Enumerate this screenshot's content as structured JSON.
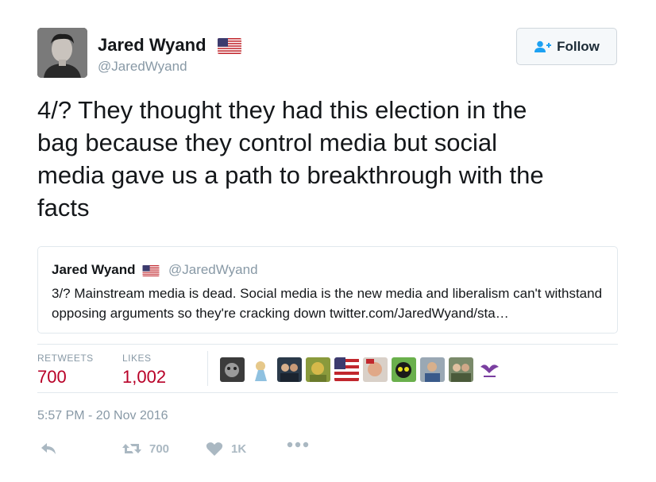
{
  "author": {
    "name": "Jared Wyand",
    "handle": "@JaredWyand"
  },
  "follow_label": "Follow",
  "tweet_text": "4/? They thought they had this election in the\nbag because they control media but social\nmedia gave us a path to breakthrough with the\nfacts",
  "quoted": {
    "name": "Jared Wyand",
    "handle": "@JaredWyand",
    "text": "3/? Mainstream media is dead. Social media is the new media and liberalism can't withstand opposing arguments so they're cracking down twitter.com/JaredWyand/sta…"
  },
  "stats": {
    "retweets_label": "RETWEETS",
    "retweets_value": "700",
    "likes_label": "LIKES",
    "likes_value": "1,002"
  },
  "timestamp": "5:57 PM - 20 Nov 2016",
  "actions": {
    "retweet_count": "700",
    "like_count": "1K"
  },
  "colors": {
    "accent_red": "#b80027",
    "muted": "#8899a6",
    "follow_icon": "#1da1f2"
  }
}
